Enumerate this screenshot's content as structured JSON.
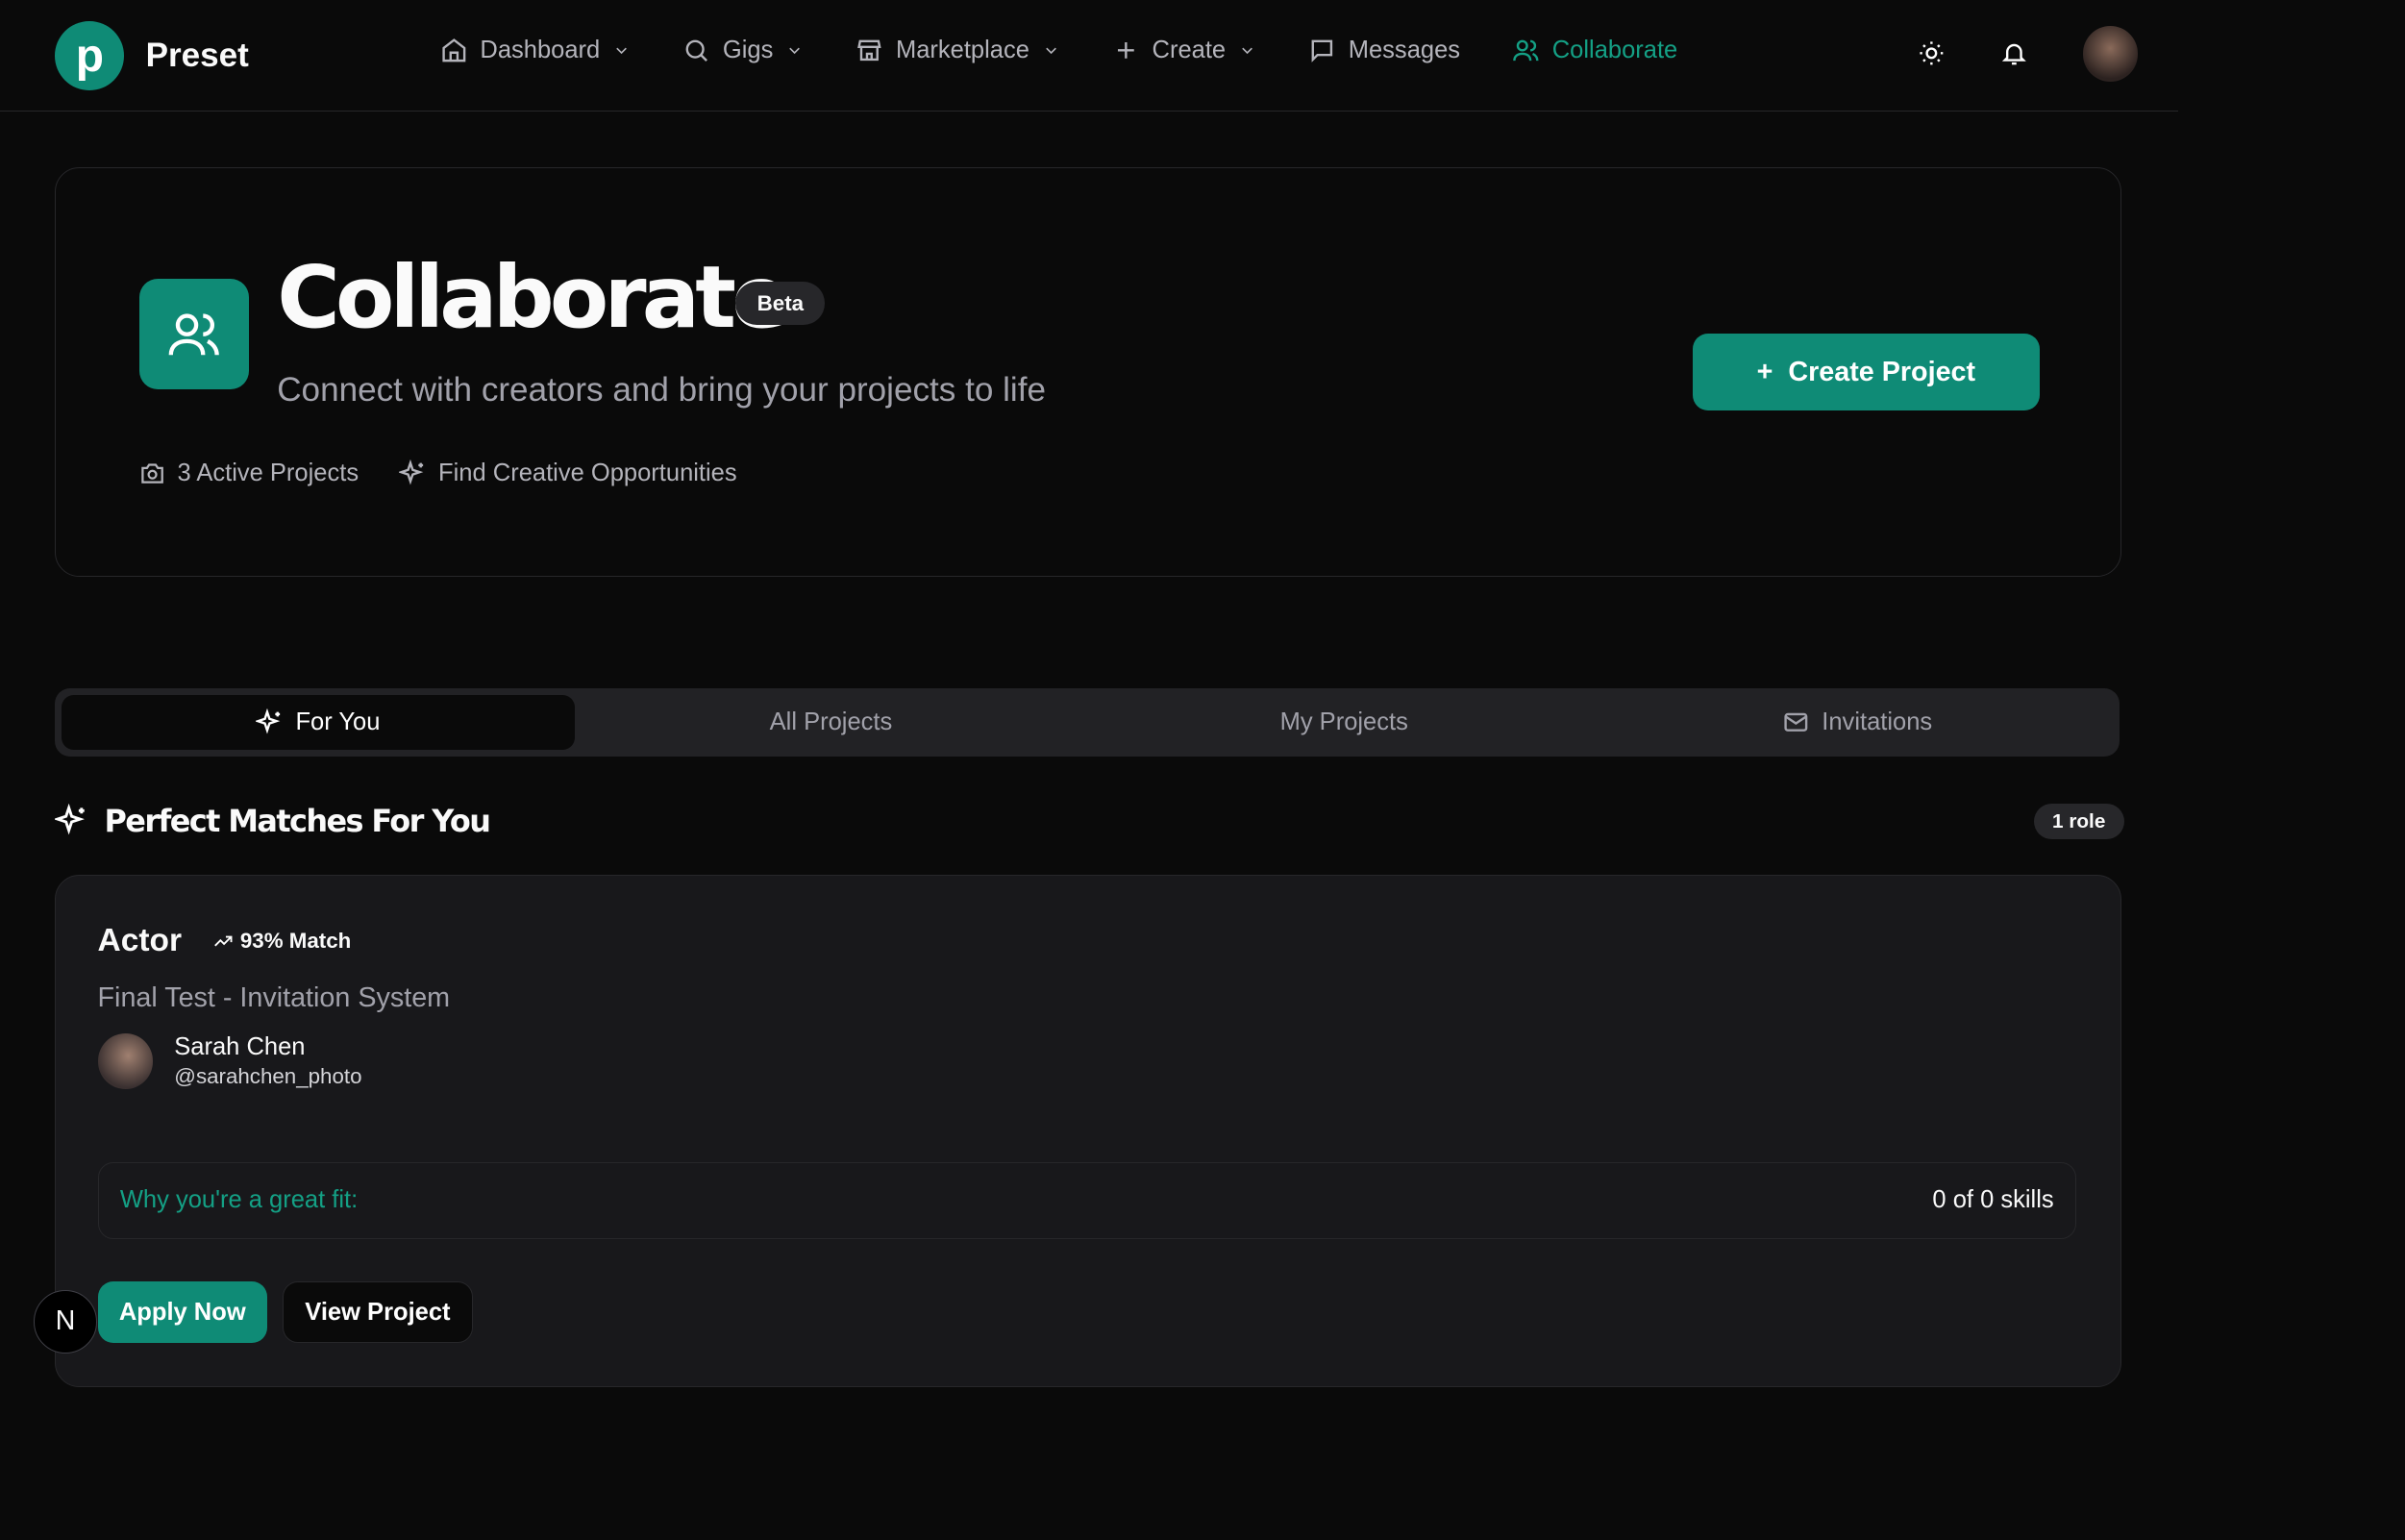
{
  "brand": {
    "name": "Preset",
    "logo_letter": "p"
  },
  "nav": {
    "items": [
      {
        "label": "Dashboard",
        "icon": "home-icon",
        "dropdown": true
      },
      {
        "label": "Gigs",
        "icon": "search-icon",
        "dropdown": true
      },
      {
        "label": "Marketplace",
        "icon": "store-icon",
        "dropdown": true
      },
      {
        "label": "Create",
        "icon": "plus-icon",
        "dropdown": true
      },
      {
        "label": "Messages",
        "icon": "message-icon",
        "dropdown": false
      },
      {
        "label": "Collaborate",
        "icon": "users-icon",
        "dropdown": false,
        "active": true
      }
    ]
  },
  "hero": {
    "title": "Collaborate",
    "badge": "Beta",
    "subtitle": "Connect with creators and bring your projects to life",
    "meta": [
      "3 Active Projects",
      "Find Creative Opportunities"
    ],
    "create_button": "Create Project"
  },
  "tabs": [
    "For You",
    "All Projects",
    "My Projects",
    "Invitations"
  ],
  "section": {
    "title": "Perfect Matches For You",
    "count": "1 role"
  },
  "match_card": {
    "role": "Actor",
    "match": "93% Match",
    "project": "Final Test - Invitation System",
    "user_name": "Sarah Chen",
    "user_handle": "@sarahchen_photo",
    "fit_label": "Why you're a great fit:",
    "fit_value": "0 of 0 skills",
    "apply": "Apply Now",
    "view": "View Project"
  },
  "dev_badge": "N",
  "colors": {
    "accent": "#0f8b76",
    "bg": "#0a0a0a",
    "card": "#18181b"
  }
}
